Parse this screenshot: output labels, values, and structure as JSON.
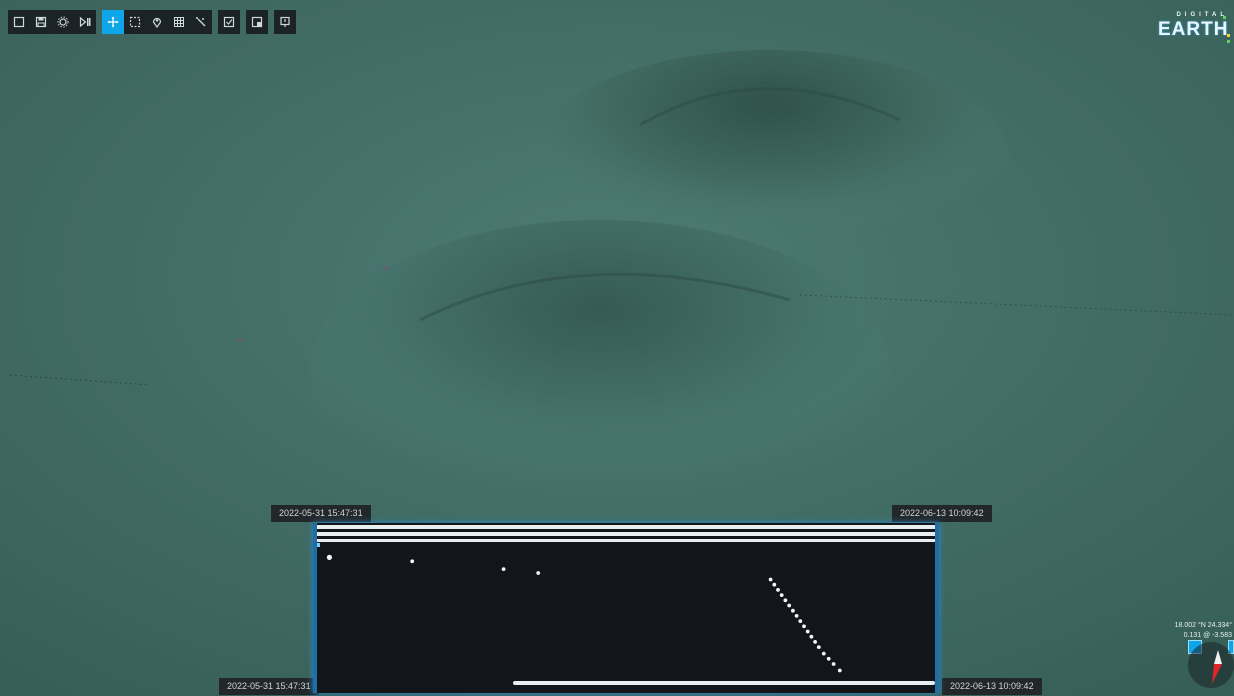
{
  "toolbar": {
    "groups": [
      [
        "new-file-icon",
        "save-icon",
        "settings-icon",
        "play-step-icon"
      ],
      [
        "move-icon",
        "select-box-icon",
        "location-pin-icon",
        "grid-icon",
        "magic-icon"
      ],
      [
        "checklist-icon"
      ],
      [
        "export-icon"
      ],
      [
        "info-icon"
      ]
    ],
    "active": "move-icon"
  },
  "logo": {
    "top": "DIGITAL",
    "main": "EARTH"
  },
  "timeline": {
    "top_start": "2022-05-31 15:47:31",
    "top_end": "2022-06-13 10:09:42",
    "bottom_start": "2022-05-31 15:47:31",
    "bottom_end": "2022-06-13 10:09:42",
    "points": [
      [
        0.02,
        0.08
      ],
      [
        0.154,
        0.11
      ],
      [
        0.302,
        0.17
      ],
      [
        0.358,
        0.2
      ],
      [
        0.734,
        0.25
      ],
      [
        0.74,
        0.29
      ],
      [
        0.746,
        0.33
      ],
      [
        0.752,
        0.37
      ],
      [
        0.758,
        0.41
      ],
      [
        0.764,
        0.45
      ],
      [
        0.77,
        0.49
      ],
      [
        0.776,
        0.53
      ],
      [
        0.782,
        0.57
      ],
      [
        0.788,
        0.61
      ],
      [
        0.794,
        0.65
      ],
      [
        0.8,
        0.69
      ],
      [
        0.806,
        0.73
      ],
      [
        0.812,
        0.77
      ],
      [
        0.82,
        0.82
      ],
      [
        0.828,
        0.86
      ],
      [
        0.836,
        0.9
      ],
      [
        0.846,
        0.95
      ]
    ]
  },
  "coords": {
    "line1": "18.002 °N 24.334°",
    "line2": "0.131 @ -3.583"
  },
  "colors": {
    "accent": "#0ea5e9",
    "seafloor": "#3f6a62",
    "panel": "#12161a"
  }
}
